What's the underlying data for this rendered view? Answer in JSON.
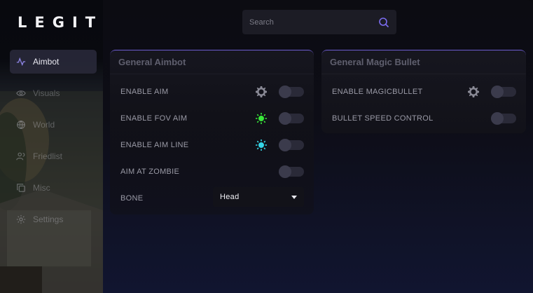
{
  "app": {
    "logo": "LEGIT"
  },
  "search": {
    "placeholder": "Search"
  },
  "sidebar": {
    "items": [
      {
        "label": "Aimbot",
        "icon": "activity-icon",
        "active": true
      },
      {
        "label": "Visuals",
        "icon": "eye-icon",
        "active": false
      },
      {
        "label": "World",
        "icon": "globe-icon",
        "active": false
      },
      {
        "label": "Friedlist",
        "icon": "users-icon",
        "active": false
      },
      {
        "label": "Misc",
        "icon": "copy-icon",
        "active": false
      },
      {
        "label": "Settings",
        "icon": "settings-icon",
        "active": false
      }
    ]
  },
  "panels": {
    "aimbot": {
      "title": "General Aimbot",
      "rows": [
        {
          "label": "ENABLE AIM",
          "icon": "gear-icon",
          "on": false
        },
        {
          "label": "ENABLE FOV AIM",
          "icon": "color-sun-icon",
          "icon_color": "#39e83a",
          "on": false
        },
        {
          "label": "ENABLE AIM LINE",
          "icon": "color-sun-icon",
          "icon_color": "#35d6e8",
          "on": false
        },
        {
          "label": "AIM AT ZOMBIE",
          "on": false
        }
      ],
      "bone": {
        "label": "BONE",
        "value": "Head"
      }
    },
    "magic": {
      "title": "General Magic Bullet",
      "rows": [
        {
          "label": "ENABLE MAGICBULLET",
          "icon": "gear-icon",
          "on": false
        },
        {
          "label": "BULLET SPEED CONTROL",
          "on": false
        }
      ]
    }
  },
  "colors": {
    "accent": "#6c5ccf",
    "search_icon": "#7b6cf0"
  }
}
